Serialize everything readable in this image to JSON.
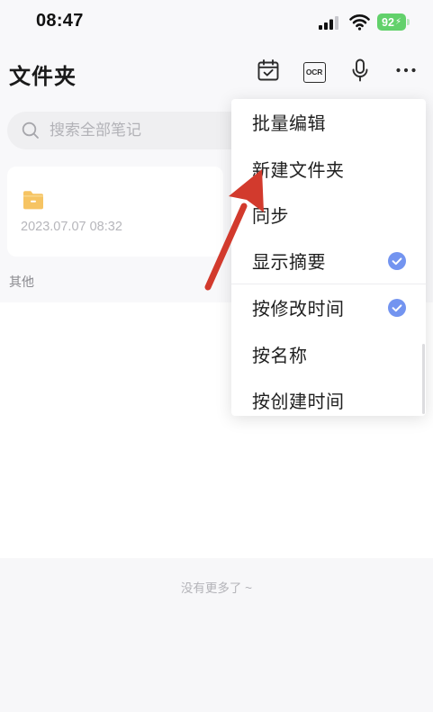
{
  "status_bar": {
    "time": "08:47",
    "battery": "92"
  },
  "header": {
    "title": "文件夹",
    "ocr_label": "OCR",
    "actions": [
      "calendar-check-icon",
      "ocr-icon",
      "microphone-icon",
      "more-icon"
    ]
  },
  "search": {
    "placeholder": "搜索全部笔记",
    "icon": "search-icon"
  },
  "folders": [
    {
      "icon": "folder-icon",
      "date": "2023.07.07 08:32"
    }
  ],
  "section_label": "其他",
  "footer": "没有更多了 ~",
  "menu": {
    "items": [
      {
        "label": "批量编辑",
        "checked": false
      },
      {
        "label": "新建文件夹",
        "checked": false
      },
      {
        "label": "同步",
        "checked": false
      },
      {
        "label": "显示摘要",
        "checked": true
      },
      {
        "label": "按修改时间",
        "checked": true
      },
      {
        "label": "按名称",
        "checked": false
      },
      {
        "label": "按创建时间",
        "checked": false
      }
    ]
  },
  "colors": {
    "accent": "#7394f0",
    "annotation_arrow": "#d23a2d",
    "folder": "#f6c463",
    "battery": "#62d16b"
  }
}
